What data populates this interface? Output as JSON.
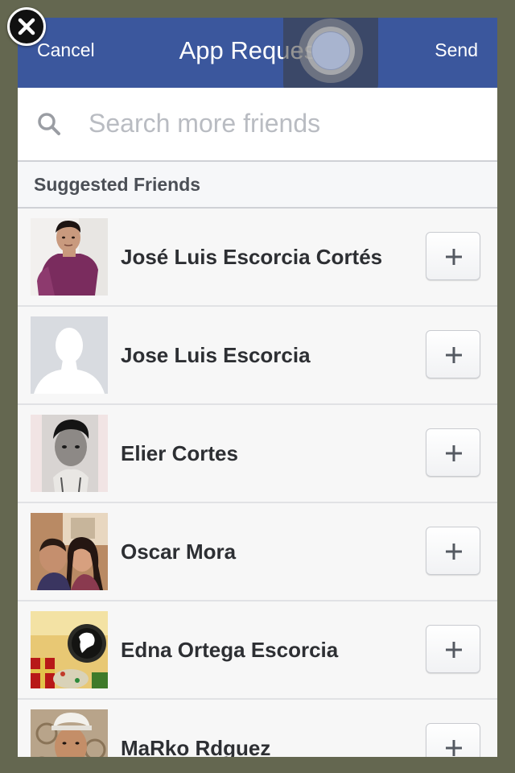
{
  "header": {
    "cancel_label": "Cancel",
    "title": "App Requests",
    "send_label": "Send",
    "background_color": "#3b579d"
  },
  "search": {
    "placeholder": "Search more friends",
    "value": ""
  },
  "section": {
    "label": "Suggested Friends"
  },
  "friends": [
    {
      "name": "José Luis Escorcia Cortés",
      "avatar": "photo-man-purple-shirt"
    },
    {
      "name": "Jose Luis Escorcia",
      "avatar": "default-silhouette"
    },
    {
      "name": "Elier Cortes",
      "avatar": "photo-bw-portrait"
    },
    {
      "name": "Oscar Mora",
      "avatar": "photo-couple"
    },
    {
      "name": "Edna Ortega Escorcia",
      "avatar": "photo-christmas-logo"
    },
    {
      "name": "MaRko Rdguez",
      "avatar": "photo-man-cap"
    }
  ],
  "add_button_label": "+",
  "icons": {
    "close": "close-icon",
    "search": "search-icon",
    "add": "plus-icon"
  }
}
